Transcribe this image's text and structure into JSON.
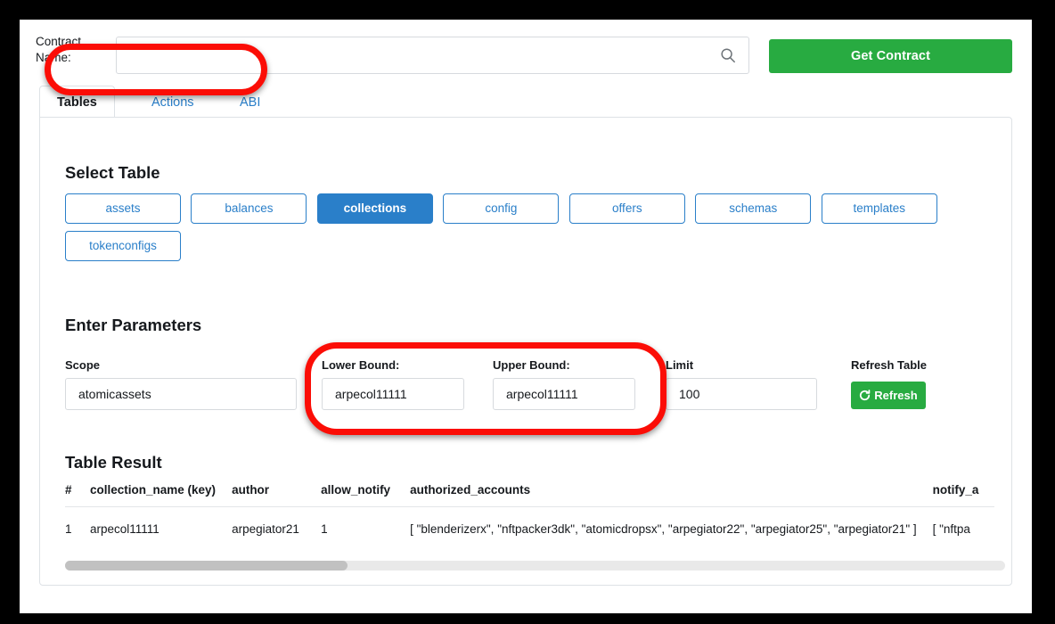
{
  "topbar": {
    "contract_label": "Contract Name:",
    "search_value": "",
    "search_placeholder": "",
    "search_icon": "search-icon",
    "get_contract_label": "Get Contract",
    "get_contract_color": "#28ab41"
  },
  "tabs": [
    {
      "label": "Tables",
      "active": true
    },
    {
      "label": "Actions",
      "active": false
    },
    {
      "label": "ABI",
      "active": false
    }
  ],
  "select_table": {
    "title": "Select Table",
    "active_color": "#2a7fc9",
    "items": [
      {
        "label": "assets",
        "active": false
      },
      {
        "label": "balances",
        "active": false
      },
      {
        "label": "collections",
        "active": true
      },
      {
        "label": "config",
        "active": false
      },
      {
        "label": "offers",
        "active": false
      },
      {
        "label": "schemas",
        "active": false
      },
      {
        "label": "templates",
        "active": false
      },
      {
        "label": "tokenconfigs",
        "active": false
      }
    ]
  },
  "parameters": {
    "title": "Enter Parameters",
    "scope": {
      "label": "Scope",
      "value": "atomicassets"
    },
    "lower_bound": {
      "label": "Lower Bound:",
      "value": "arpecol11111"
    },
    "upper_bound": {
      "label": "Upper Bound:",
      "value": "arpecol11111"
    },
    "limit": {
      "label": "Limit",
      "value": "100"
    },
    "refresh": {
      "label": "Refresh Table",
      "button_label": "Refresh",
      "icon": "refresh-icon",
      "color": "#28ab41"
    }
  },
  "result": {
    "title": "Table Result",
    "columns": [
      "#",
      "collection_name (key)",
      "author",
      "allow_notify",
      "authorized_accounts",
      "notify_a"
    ],
    "rows": [
      {
        "index": "1",
        "collection_name": "arpecol11111",
        "author": "arpegiator21",
        "allow_notify": "1",
        "authorized_accounts": "[ \"blenderizerx\", \"nftpacker3dk\", \"atomicdropsx\", \"arpegiator22\", \"arpegiator25\", \"arpegiator21\" ]",
        "notify_accounts": "[ \"nftpa"
      }
    ],
    "scrollbar": {
      "thumb_percent": 30
    }
  },
  "annotations": {
    "color": "#fb0d06",
    "items": [
      {
        "name": "contract-name-highlight"
      },
      {
        "name": "bounds-highlight"
      }
    ]
  }
}
